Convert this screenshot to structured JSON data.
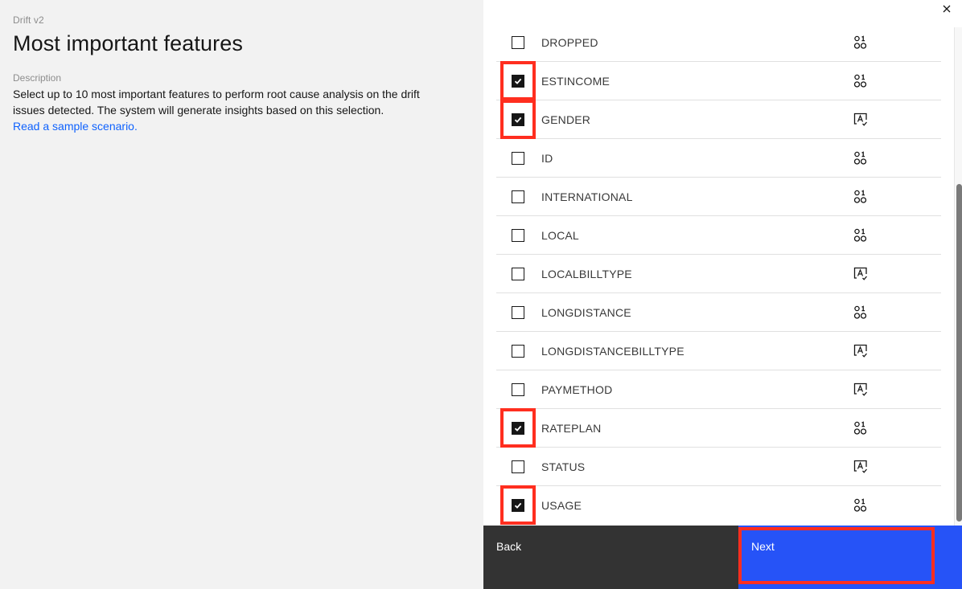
{
  "left": {
    "product": "Drift v2",
    "title": "Most important features",
    "description_label": "Description",
    "description_text": "Select up to 10 most important features to perform root cause analysis on the drift issues detected. The system will generate insights based on this selection.",
    "link_text": "Read a sample scenario."
  },
  "panel": {
    "close_icon": "close-icon",
    "features": [
      {
        "name": "DROPPED",
        "checked": false,
        "type": "numeric",
        "icon": "numeric-icon",
        "highlighted": false
      },
      {
        "name": "ESTINCOME",
        "checked": true,
        "type": "numeric",
        "icon": "numeric-icon",
        "highlighted": true
      },
      {
        "name": "GENDER",
        "checked": true,
        "type": "categorical",
        "icon": "categorical-icon",
        "highlighted": true
      },
      {
        "name": "ID",
        "checked": false,
        "type": "numeric",
        "icon": "numeric-icon",
        "highlighted": false
      },
      {
        "name": "INTERNATIONAL",
        "checked": false,
        "type": "numeric",
        "icon": "numeric-icon",
        "highlighted": false
      },
      {
        "name": "LOCAL",
        "checked": false,
        "type": "numeric",
        "icon": "numeric-icon",
        "highlighted": false
      },
      {
        "name": "LOCALBILLTYPE",
        "checked": false,
        "type": "categorical",
        "icon": "categorical-icon",
        "highlighted": false
      },
      {
        "name": "LONGDISTANCE",
        "checked": false,
        "type": "numeric",
        "icon": "numeric-icon",
        "highlighted": false
      },
      {
        "name": "LONGDISTANCEBILLTYPE",
        "checked": false,
        "type": "categorical",
        "icon": "categorical-icon",
        "highlighted": false
      },
      {
        "name": "PAYMETHOD",
        "checked": false,
        "type": "categorical",
        "icon": "categorical-icon",
        "highlighted": false
      },
      {
        "name": "RATEPLAN",
        "checked": true,
        "type": "numeric",
        "icon": "numeric-icon",
        "highlighted": true
      },
      {
        "name": "STATUS",
        "checked": false,
        "type": "categorical",
        "icon": "categorical-icon",
        "highlighted": false
      },
      {
        "name": "USAGE",
        "checked": true,
        "type": "numeric",
        "icon": "numeric-icon",
        "highlighted": true
      }
    ],
    "back_label": "Back",
    "next_label": "Next",
    "next_highlighted": true
  },
  "colors": {
    "link": "#0f62fe",
    "primary_button": "#2653f7",
    "secondary_button": "#333333",
    "highlight": "#ff2e1f",
    "checkbox_checked": "#161616"
  }
}
